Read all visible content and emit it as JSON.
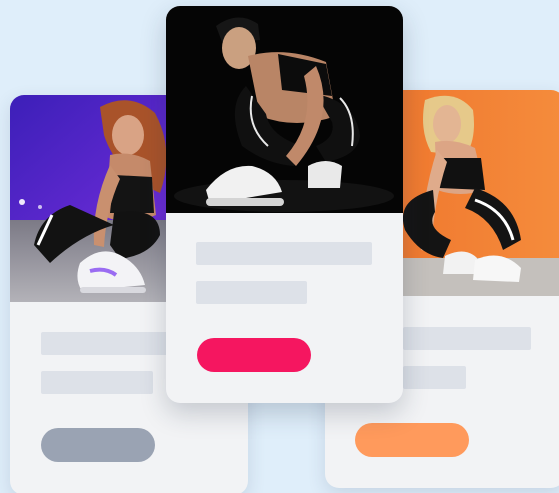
{
  "cards": [
    {
      "id": "left",
      "photo": "sneaker-photo-purple-background",
      "button_color": "#9aa3b3"
    },
    {
      "id": "center",
      "photo": "sneaker-photo-black-background",
      "button_color": "#f51660"
    },
    {
      "id": "right",
      "photo": "sneaker-photo-orange-background",
      "button_color": "#ff9a5c"
    }
  ],
  "colors": {
    "page_background": "#dfeefa",
    "card_background": "#f2f3f5",
    "placeholder_bar": "#dde1e8"
  }
}
